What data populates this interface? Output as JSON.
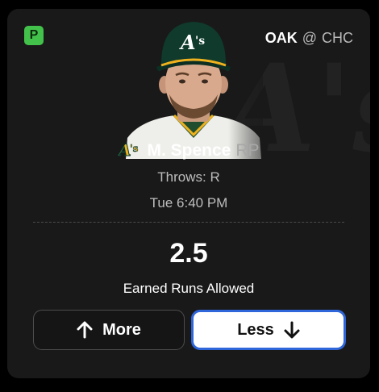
{
  "badge": {
    "letter": "P",
    "color": "#43c24b"
  },
  "matchup": {
    "team": "OAK",
    "separator": "@",
    "opponent": "CHC"
  },
  "player": {
    "name": "M. Spence",
    "position": "RP",
    "throws": "Throws: R",
    "game_time": "Tue 6:40 PM",
    "team_logo_icon": "athletics-logo-icon",
    "headshot": "player-headshot"
  },
  "projection": {
    "line": "2.5",
    "stat": "Earned Runs Allowed"
  },
  "actions": {
    "more_label": "More",
    "less_label": "Less",
    "selected": "Less"
  },
  "colors": {
    "card_bg": "#191919",
    "accent_blue": "#2f66d9",
    "team_gold": "#efb21e",
    "team_green": "#003831"
  }
}
